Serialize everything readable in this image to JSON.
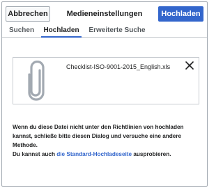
{
  "header": {
    "cancel_label": "Abbrechen",
    "title": "Medieneinstellungen",
    "upload_label": "Hochladen"
  },
  "tabs": [
    {
      "label": "Suchen"
    },
    {
      "label": "Hochladen",
      "active": true
    },
    {
      "label": "Erweiterte Suche"
    }
  ],
  "file": {
    "name": "Checklist-ISO-9001-2015_English.xls",
    "icon": "paperclip-icon",
    "remove_icon": "close-icon"
  },
  "message": {
    "policy_text": "Wenn du diese Datei nicht unter den Richtlinien von hochladen kannst, schließe bitte diesen Dialog und versuche eine andere Methode.",
    "alt_prefix": "Du kannst auch ",
    "alt_link": "die Standard-Hochladeseite",
    "alt_suffix": " ausprobieren."
  },
  "colors": {
    "accent": "#3366cc",
    "border": "#a2a9b1",
    "icon_gray": "#a2a9b1"
  }
}
